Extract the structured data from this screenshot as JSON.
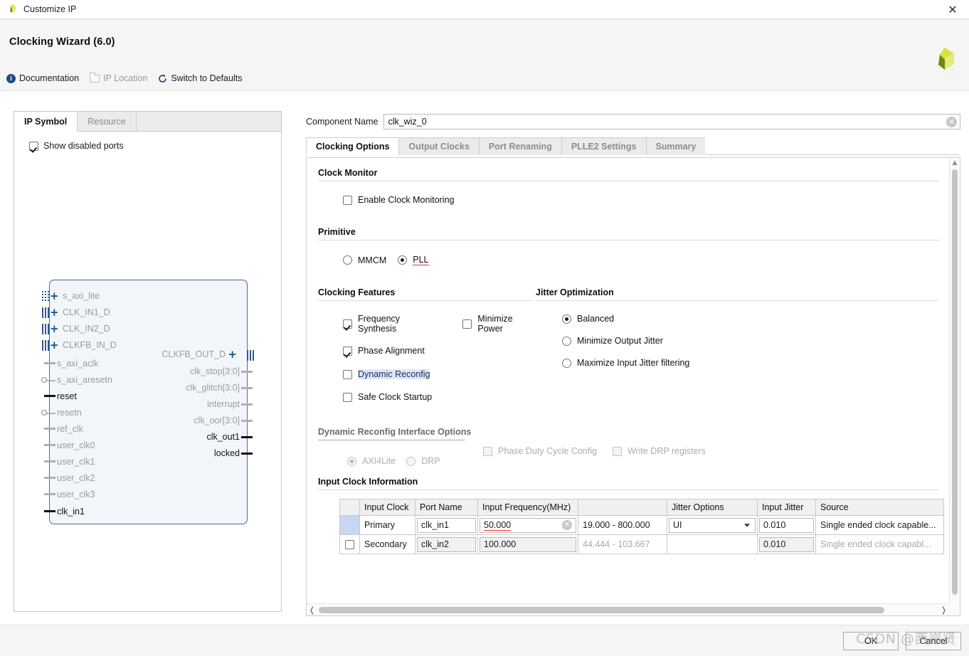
{
  "window": {
    "title": "Customize IP",
    "close_label": "✕"
  },
  "header": {
    "title": "Clocking Wizard (6.0)",
    "links": [
      {
        "label": "Documentation",
        "icon": "info-icon",
        "enabled": true
      },
      {
        "label": "IP Location",
        "icon": "folder-icon",
        "enabled": false
      },
      {
        "label": "Switch to Defaults",
        "icon": "refresh-icon",
        "enabled": true
      }
    ]
  },
  "left_panel": {
    "tabs": [
      {
        "label": "IP Symbol",
        "active": true
      },
      {
        "label": "Resource",
        "active": false
      }
    ],
    "show_disabled_ports": {
      "label": "Show disabled ports",
      "checked": true
    },
    "symbol": {
      "inputs": [
        {
          "label": "s_axi_lite",
          "enabled": false,
          "kind": "bus-dotted",
          "expandable": true
        },
        {
          "label": "CLK_IN1_D",
          "enabled": false,
          "kind": "bus",
          "expandable": true
        },
        {
          "label": "CLK_IN2_D",
          "enabled": false,
          "kind": "bus",
          "expandable": true
        },
        {
          "label": "CLKFB_IN_D",
          "enabled": false,
          "kind": "bus",
          "expandable": true
        },
        {
          "label": "s_axi_aclk",
          "enabled": false,
          "kind": "pin"
        },
        {
          "label": "s_axi_aresetn",
          "enabled": false,
          "kind": "pin-inv"
        },
        {
          "label": "reset",
          "enabled": true,
          "kind": "pin"
        },
        {
          "label": "resetn",
          "enabled": false,
          "kind": "pin-inv"
        },
        {
          "label": "ref_clk",
          "enabled": false,
          "kind": "pin"
        },
        {
          "label": "user_clk0",
          "enabled": false,
          "kind": "pin"
        },
        {
          "label": "user_clk1",
          "enabled": false,
          "kind": "pin"
        },
        {
          "label": "user_clk2",
          "enabled": false,
          "kind": "pin"
        },
        {
          "label": "user_clk3",
          "enabled": false,
          "kind": "pin"
        },
        {
          "label": "clk_in1",
          "enabled": true,
          "kind": "pin"
        }
      ],
      "outputs": [
        {
          "label": "CLKFB_OUT_D",
          "enabled": false,
          "kind": "bus",
          "expandable": true
        },
        {
          "label": "clk_stop[3:0]",
          "enabled": false,
          "kind": "pin"
        },
        {
          "label": "clk_glitch[3:0]",
          "enabled": false,
          "kind": "pin"
        },
        {
          "label": "interrupt",
          "enabled": false,
          "kind": "pin"
        },
        {
          "label": "clk_oor[3:0]",
          "enabled": false,
          "kind": "pin"
        },
        {
          "label": "clk_out1",
          "enabled": true,
          "kind": "pin"
        },
        {
          "label": "locked",
          "enabled": true,
          "kind": "pin"
        }
      ]
    }
  },
  "component_name": {
    "label": "Component Name",
    "value": "clk_wiz_0",
    "placeholder": "",
    "clear_icon": "✕"
  },
  "tabs": [
    {
      "label": "Clocking Options",
      "active": true
    },
    {
      "label": "Output Clocks",
      "active": false
    },
    {
      "label": "Port Renaming",
      "active": false
    },
    {
      "label": "PLLE2 Settings",
      "active": false
    },
    {
      "label": "Summary",
      "active": false
    }
  ],
  "clocking_options": {
    "clock_monitor": {
      "title": "Clock Monitor",
      "enable_clock_monitoring": {
        "label": "Enable Clock Monitoring",
        "checked": false
      }
    },
    "primitive": {
      "title": "Primitive",
      "options": [
        {
          "label": "MMCM",
          "selected": false,
          "annotated": false
        },
        {
          "label": "PLL",
          "selected": true,
          "annotated": true
        }
      ]
    },
    "clocking_features": {
      "title": "Clocking Features",
      "options": [
        {
          "label": "Frequency Synthesis",
          "checked": true,
          "enabled": true,
          "highlight": false
        },
        {
          "label": "Minimize Power",
          "checked": false,
          "enabled": true,
          "highlight": false
        },
        {
          "label": "Phase Alignment",
          "checked": true,
          "enabled": true,
          "highlight": false
        },
        {
          "label": "Dynamic Reconfig",
          "checked": false,
          "enabled": true,
          "highlight": true
        },
        {
          "label": "Safe Clock Startup",
          "checked": false,
          "enabled": true,
          "highlight": false
        }
      ]
    },
    "jitter_optimization": {
      "title": "Jitter Optimization",
      "options": [
        {
          "label": "Balanced",
          "selected": true
        },
        {
          "label": "Minimize Output Jitter",
          "selected": false
        },
        {
          "label": "Maximize Input Jitter filtering",
          "selected": false
        }
      ]
    },
    "dynamic_reconfig": {
      "title": "Dynamic Reconfig Interface Options",
      "enabled": false,
      "interface_options": [
        {
          "label": "AXI4Lite",
          "selected": true
        },
        {
          "label": "DRP",
          "selected": false
        }
      ],
      "checkboxes": [
        {
          "label": "Phase Duty Cycle Config",
          "checked": false
        },
        {
          "label": "Write DRP registers",
          "checked": false
        }
      ]
    },
    "input_clock_information": {
      "title": "Input Clock Information",
      "columns": [
        "",
        "Input Clock",
        "Port Name",
        "Input Frequency(MHz)",
        "",
        "Jitter Options",
        "Input Jitter",
        "Source"
      ],
      "rows": [
        {
          "selected": true,
          "checkbox": null,
          "input_clock": "Primary",
          "port_name": "clk_in1",
          "input_frequency": "50.000",
          "frequency_annotated": true,
          "range": "19.000 - 800.000",
          "jitter_options": "UI",
          "input_jitter": "0.010",
          "source": "Single ended clock capable...",
          "enabled": true
        },
        {
          "selected": false,
          "checkbox": {
            "checked": false
          },
          "input_clock": "Secondary",
          "port_name": "clk_in2",
          "input_frequency": "100.000",
          "frequency_annotated": false,
          "range": "44.444 - 103.667",
          "jitter_options": "",
          "input_jitter": "0.010",
          "source": "Single ended clock capabl...",
          "enabled": false
        }
      ]
    }
  },
  "footer": {
    "ok_label": "OK",
    "cancel_label": "Cancel"
  },
  "watermark": {
    "text": "CSDN @西岸贤"
  }
}
